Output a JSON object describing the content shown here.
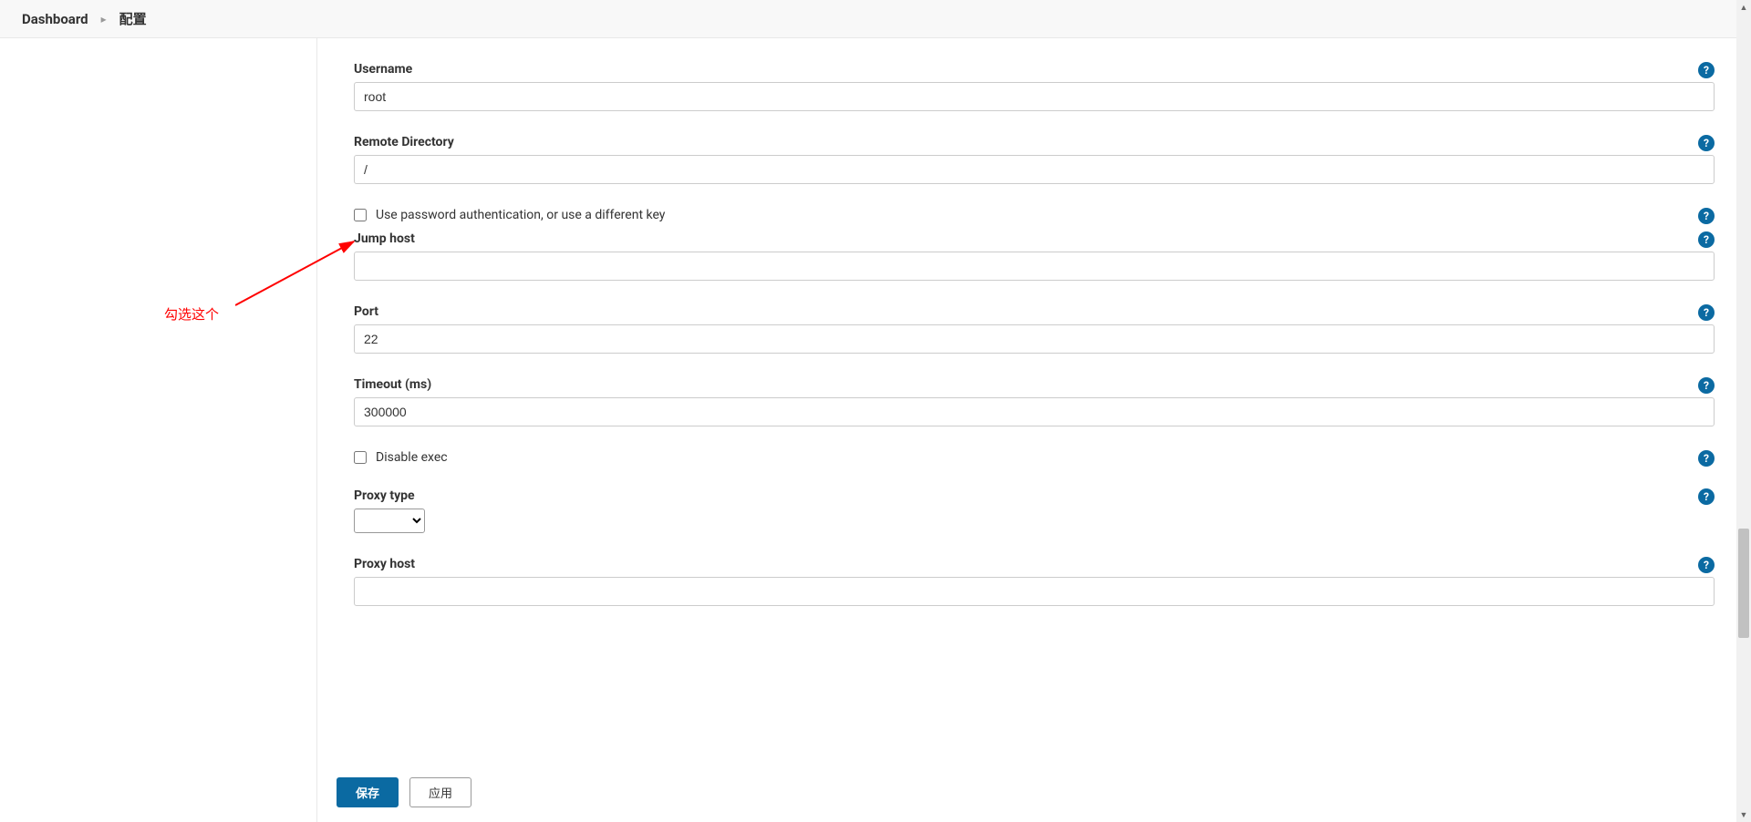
{
  "breadcrumb": {
    "root": "Dashboard",
    "current": "配置"
  },
  "annotation": {
    "text": "勾选这个"
  },
  "form": {
    "username": {
      "label": "Username",
      "value": "root"
    },
    "remote_dir": {
      "label": "Remote Directory",
      "value": "/"
    },
    "use_password": {
      "label": "Use password authentication, or use a different key",
      "checked": false
    },
    "jump_host": {
      "label": "Jump host",
      "value": ""
    },
    "port": {
      "label": "Port",
      "value": "22"
    },
    "timeout": {
      "label": "Timeout (ms)",
      "value": "300000"
    },
    "disable_exec": {
      "label": "Disable exec",
      "checked": false
    },
    "proxy_type": {
      "label": "Proxy type",
      "value": ""
    },
    "proxy_host": {
      "label": "Proxy host",
      "value": ""
    }
  },
  "footer": {
    "save": "保存",
    "apply": "应用"
  },
  "colors": {
    "accent": "#0b6aa2",
    "annotation": "#ff0000"
  }
}
